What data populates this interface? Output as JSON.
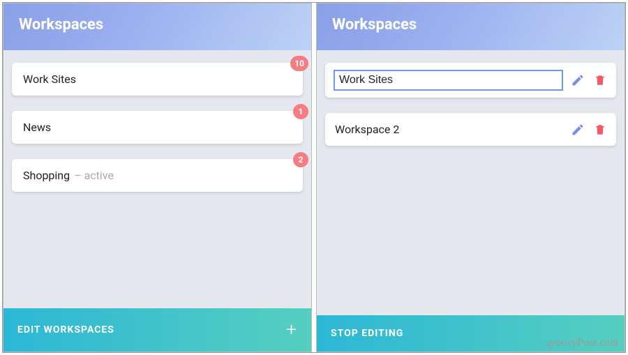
{
  "left": {
    "header": "Workspaces",
    "items": [
      {
        "name": "Work Sites",
        "badge": "10",
        "suffix": ""
      },
      {
        "name": "News",
        "badge": "1",
        "suffix": ""
      },
      {
        "name": "Shopping",
        "badge": "2",
        "suffix": "– active"
      }
    ],
    "footer": "EDIT WORKSPACES"
  },
  "right": {
    "header": "Workspaces",
    "rows": [
      {
        "name": "Work Sites",
        "editing": true
      },
      {
        "name": "Workspace 2",
        "editing": false
      }
    ],
    "footer": "STOP EDITING"
  },
  "colors": {
    "badge": "#f47c82",
    "pencil": "#7a8eea",
    "trash": "#f05a66",
    "input_border": "#6f98ea"
  },
  "watermark": "groovyPost.com"
}
